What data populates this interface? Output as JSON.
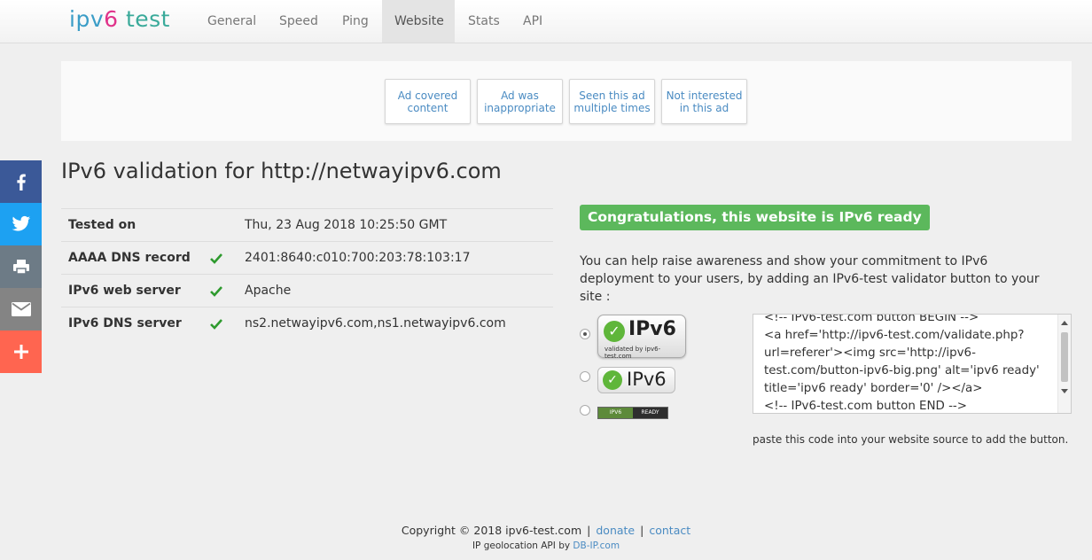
{
  "logo": {
    "part1": "ipv",
    "part2": "6",
    "part3": " test"
  },
  "nav": {
    "items": [
      "General",
      "Speed",
      "Ping",
      "Website",
      "Stats",
      "API"
    ],
    "active": "Website"
  },
  "ad_feedback": {
    "buttons": [
      [
        "Ad covered",
        "content"
      ],
      [
        "Ad was",
        "inappropriate"
      ],
      [
        "Seen this ad",
        "multiple times"
      ],
      [
        "Not interested",
        "in this ad"
      ]
    ]
  },
  "share": {
    "items": [
      {
        "icon": "facebook-icon",
        "color": "#3b5998"
      },
      {
        "icon": "twitter-icon",
        "color": "#1da1f2"
      },
      {
        "icon": "print-icon",
        "color": "#6d7b86"
      },
      {
        "icon": "mail-icon",
        "color": "#848484"
      },
      {
        "icon": "plus-icon",
        "color": "#ff6550"
      }
    ]
  },
  "title": "IPv6 validation for http://netwayipv6.com",
  "results": [
    {
      "label": "Tested on",
      "check": false,
      "value": "Thu, 23 Aug 2018 10:25:50 GMT"
    },
    {
      "label": "AAAA DNS record",
      "check": true,
      "value": "2401:8640:c010:700:203:78:103:17"
    },
    {
      "label": "IPv6 web server",
      "check": true,
      "value": "Apache"
    },
    {
      "label": "IPv6 DNS server",
      "check": true,
      "value": "ns2.netwayipv6.com,ns1.netwayipv6.com"
    }
  ],
  "congrats": "Congratulations, this website is IPv6 ready",
  "info": "You can help raise awareness and show your commitment to IPv6 deployment to your users, by adding an IPv6-test validator button to your site :",
  "badges": {
    "big_text": "IPv6",
    "big_sub": "validated by ipv6-test.com",
    "mid_text": "IPv6",
    "small_left": "IPV6",
    "small_right": "READY",
    "selected": 0
  },
  "code": "<!-- IPv6-test.com button BEGIN -->\n<a href='http://ipv6-test.com/validate.php?url=referer'><img src='http://ipv6-test.com/button-ipv6-big.png' alt='ipv6 ready' title='ipv6 ready' border='0' /></a>\n<!-- IPv6-test.com button END -->",
  "paste_note": "paste this code into your website source to add the button.",
  "footer": {
    "copyright": "Copyright © 2018 ipv6-test.com",
    "donate": "donate",
    "contact": "contact",
    "geo_prefix": "IP geolocation API by ",
    "geo_link": "DB-IP.com"
  },
  "colors": {
    "accent": "#4a8bc2",
    "success": "#5cb85c",
    "check": "#2e9a2e"
  }
}
